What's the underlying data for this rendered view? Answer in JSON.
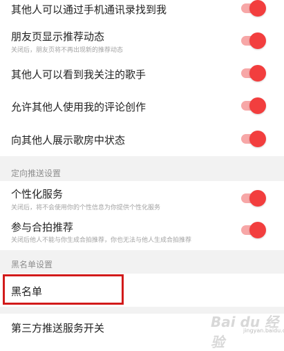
{
  "colors": {
    "accent": "#f23e3e",
    "toggle_track_on": "#f7a7a7",
    "section_bg": "#f2f2f2",
    "highlight_box": "#d21a1a"
  },
  "privacy_settings": [
    {
      "title": "其他人可以通过手机通讯录找到我",
      "enabled": true
    },
    {
      "title": "朋友页显示推荐动态",
      "subtitle": "关闭后，朋友页将不再出现新的推荐动态",
      "enabled": true
    },
    {
      "title": "其他人可以看到我关注的歌手",
      "enabled": true
    },
    {
      "title": "允许其他人使用我的评论创作",
      "enabled": true
    },
    {
      "title": "向其他人展示歌房中状态",
      "enabled": true
    }
  ],
  "push_section": {
    "header": "定向推送设置",
    "items": [
      {
        "title": "个性化服务",
        "subtitle": "关闭后，将不会使用你的个性信息为你提供个性化服务",
        "enabled": true
      },
      {
        "title": "参与合拍推荐",
        "subtitle": "关闭后他人不能与你生成合拍推荐，你也无法与他人生成合拍推荐",
        "enabled": true
      }
    ]
  },
  "blacklist_section": {
    "header": "黑名单设置",
    "item": "黑名单"
  },
  "third_party": {
    "title": "第三方推送服务开关"
  },
  "watermark": {
    "text": "Bai du 经验",
    "sub": "jingyan.baidu.com"
  }
}
